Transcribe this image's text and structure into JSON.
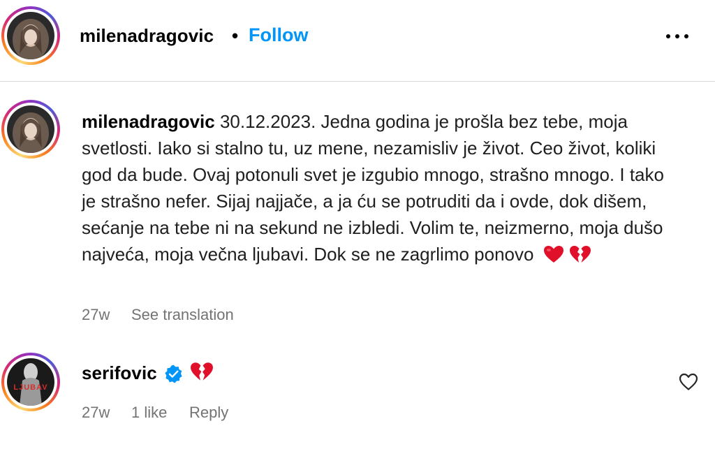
{
  "header": {
    "username": "milenadragovic",
    "separator": "•",
    "follow_label": "Follow"
  },
  "caption": {
    "username": "milenadragovic",
    "text": "30.12.2023. Jedna godina je prošla bez tebe, moja svetlosti. Iako si stalno tu, uz mene, nezamisliv je život. Ceo život, koliki god da bude. Ovaj potonuli svet je izgubio mnogo, strašno mnogo. I tako je strašno nefer. Sijaj najjače, a ja ću se potruditi da i ovde, dok dišem, sećanje na tebe ni na sekund ne izbledi. Volim te, neizmerno, moja dušo najveća, moja večna ljubavi. Dok se ne zagrlimo ponovo",
    "emojis": [
      "red-heart-icon",
      "broken-heart-icon"
    ],
    "age": "27w",
    "see_translation": "See translation"
  },
  "comment": {
    "username": "serifovic",
    "verified": true,
    "emoji": "broken-heart-icon",
    "avatar_text": "LJUBAV",
    "age": "27w",
    "likes": "1 like",
    "reply_label": "Reply"
  },
  "colors": {
    "accent": "#0095f6",
    "secondary_text": "#737373",
    "heart_red": "#e0102a"
  }
}
